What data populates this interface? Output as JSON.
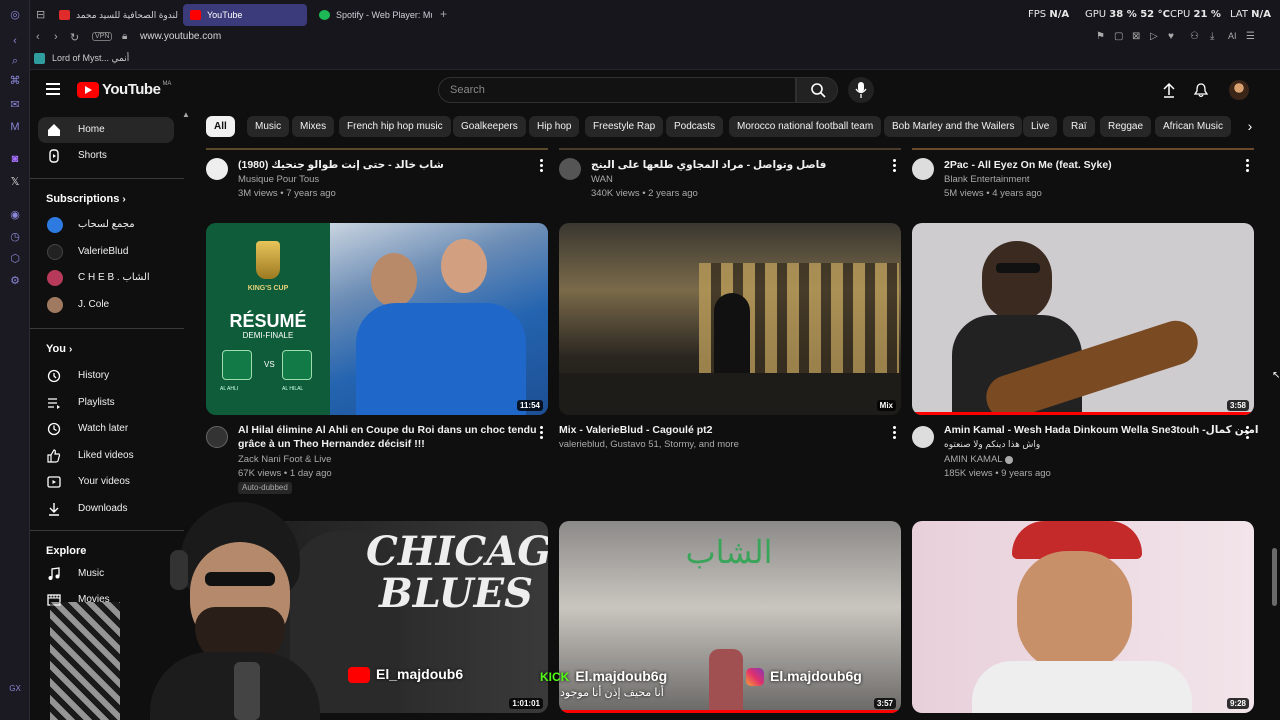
{
  "browser": {
    "tabs": [
      {
        "label": "الندوة الصحافية للسيد محمد"
      },
      {
        "label": "YouTube"
      },
      {
        "label": "Spotify - Web Player: Musi"
      }
    ],
    "hud": {
      "fps_label": "FPS",
      "fps_value": "N/A",
      "gpu_label": "GPU",
      "gpu_value": "38 %  52 °C",
      "cpu_label": "CPU",
      "cpu_value": "21 %",
      "lat_label": "LAT",
      "lat_value": "N/A"
    },
    "url": "www.youtube.com",
    "vpn": "VPN",
    "bookmark": "Lord of Myst... أنمي"
  },
  "header": {
    "logo_text": "YouTube",
    "region": "MA",
    "search_placeholder": "Search"
  },
  "sidebar": {
    "main": [
      {
        "label": "Home"
      },
      {
        "label": "Shorts"
      }
    ],
    "subscriptions_title": "Subscriptions",
    "subscriptions": [
      {
        "label": "مجمع لسحاب"
      },
      {
        "label": "ValerieBlud"
      },
      {
        "label": "C H E B . الشاب"
      },
      {
        "label": "J. Cole"
      }
    ],
    "you_title": "You",
    "you_items": [
      {
        "label": "History"
      },
      {
        "label": "Playlists"
      },
      {
        "label": "Watch later"
      },
      {
        "label": "Liked videos"
      },
      {
        "label": "Your videos"
      },
      {
        "label": "Downloads"
      }
    ],
    "explore_title": "Explore",
    "explore_items": [
      {
        "label": "Music"
      },
      {
        "label": "Movies"
      }
    ]
  },
  "chips": [
    "All",
    "Music",
    "Mixes",
    "French hip hop music",
    "Goalkeepers",
    "Hip hop",
    "Freestyle Rap",
    "Podcasts",
    "Morocco national football team",
    "Bob Marley and the Wailers",
    "Live",
    "Raï",
    "Reggae",
    "African Music"
  ],
  "top_row": [
    {
      "title": "شاب خالد - حتى إنت طوالو جنحيك (1980)",
      "channel": "Musique Pour Tous",
      "stats": "3M views • 7 years ago"
    },
    {
      "title": "فاصل وتواصل - مراد المجاوي طلعها على الينج",
      "channel": "WAN",
      "stats": "340K views • 2 years ago"
    },
    {
      "title": "2Pac - All Eyez On Me (feat. Syke)",
      "channel": "Blank Entertainment",
      "stats": "5M views • 4 years ago"
    }
  ],
  "middle_row": [
    {
      "title": "Al Hilal élimine Al Ahli en Coupe du Roi dans un choc tendu grâce à un Theo Hernandez décisif !!!",
      "channel": "Zack Nani Foot & Live",
      "stats": "67K views • 1 day ago",
      "badge": "Auto-dubbed",
      "duration": "11:54",
      "thumb_cup": "KING'S CUP",
      "thumb_resume": "RÉSUMÉ",
      "thumb_round": "DEMI-FINALE",
      "thumb_vs": "VS",
      "thumb_team1": "AL AHLI",
      "thumb_team2": "AL HILAL"
    },
    {
      "title": "Mix - ValerieBlud - Cagoulé pt2",
      "channel": "valerieblud, Gustavo 51, Stormy, and more",
      "duration": "Mix"
    },
    {
      "title": "Amin Kamal - Wesh Hada Dinkoum Wella Sne3touh -امين كمال",
      "title2": "واش هذا دينكم ولا صنعتوه",
      "channel": "AMIN KAMAL",
      "stats": "185K views • 9 years ago",
      "duration": "3:58",
      "progress": 1.0
    }
  ],
  "bottom_row": [
    {
      "thumb_text": "CHICAGO BLUES",
      "duration": "1:01:01"
    },
    {
      "thumb_text": "الشاب",
      "duration": "3:57"
    },
    {
      "duration": "9:28"
    }
  ],
  "overlays": {
    "youtube_handle": "El_majdoub6",
    "kick_label": "KICK",
    "kick_handle": "El.majdoub6g",
    "insta_handle": "El.majdoub6g",
    "arabic_caption": "أنا محيف إذن أنا موجود"
  }
}
